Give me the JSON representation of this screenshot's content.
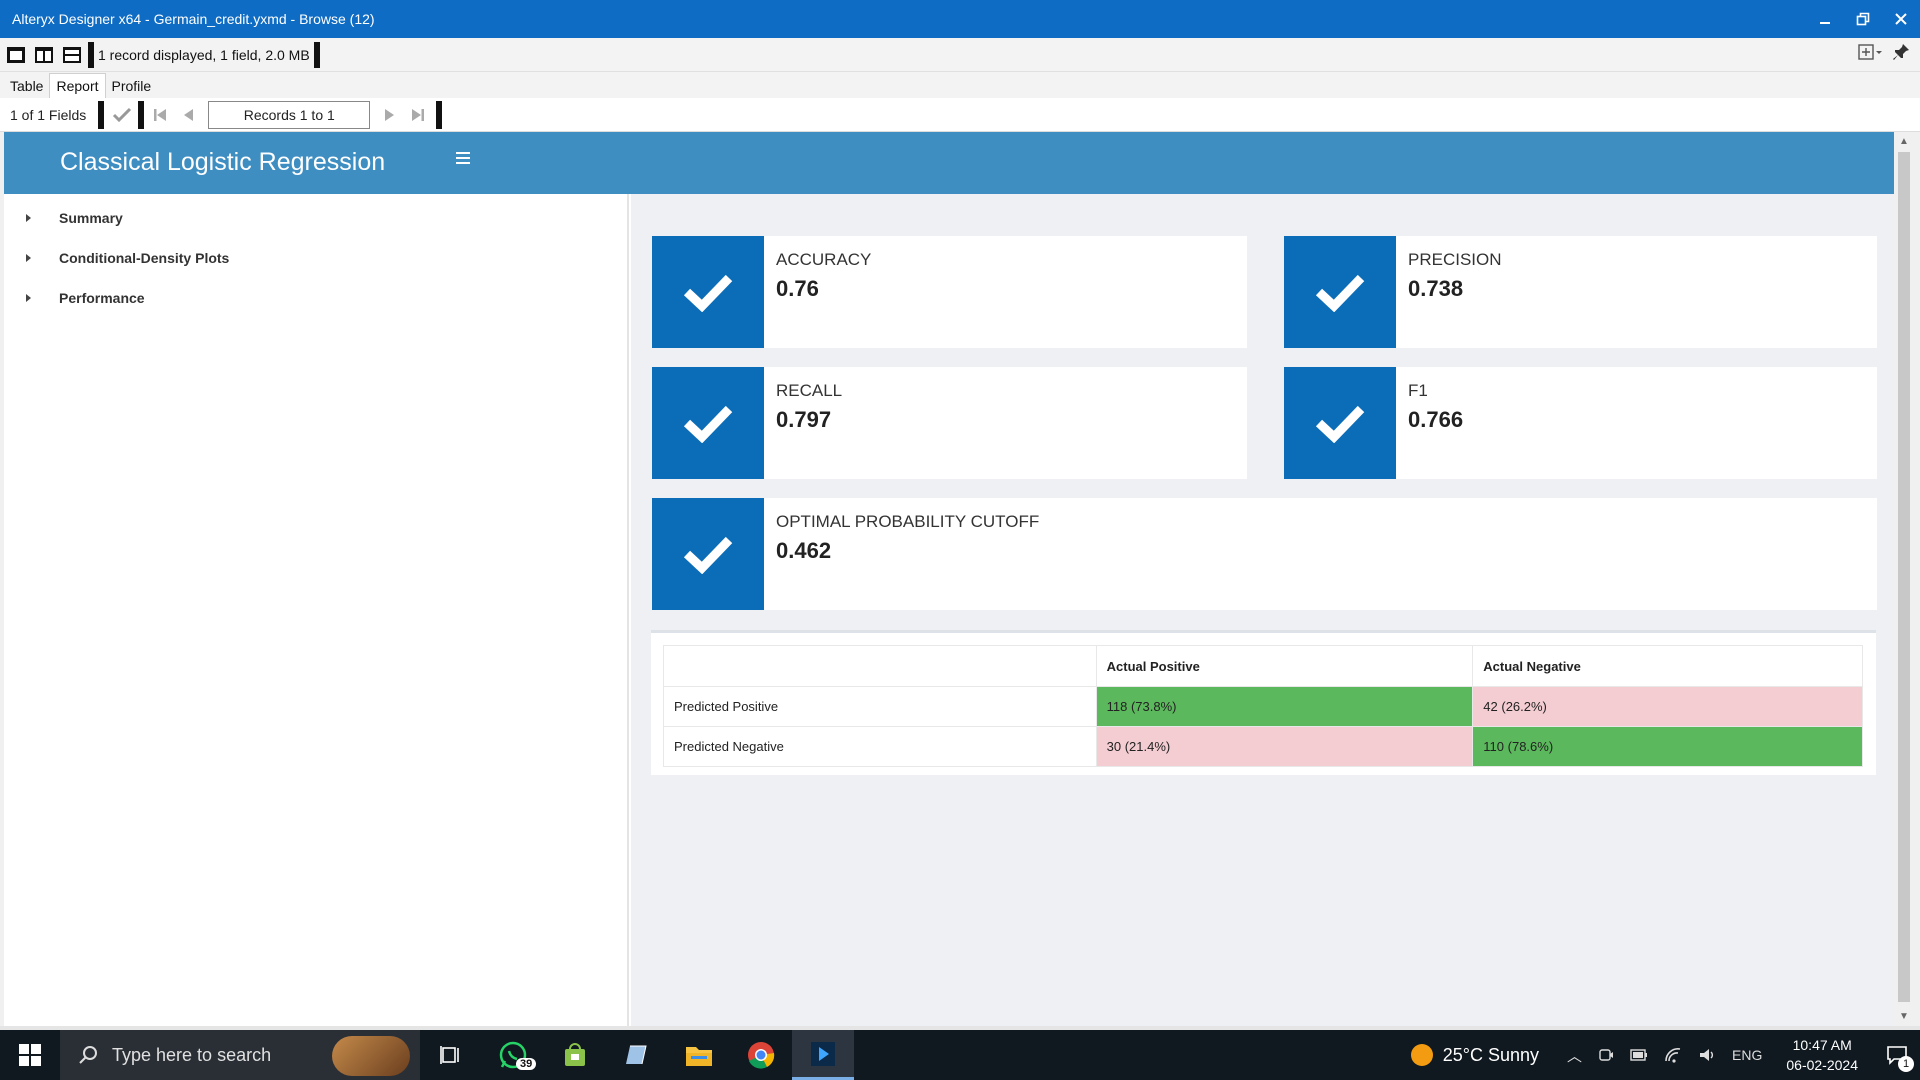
{
  "window": {
    "title": "Alteryx Designer x64 - Germain_credit.yxmd - Browse (12)"
  },
  "toolbar": {
    "info": "1 record displayed, 1 field, 2.0 MB"
  },
  "tabs": [
    {
      "label": "Table"
    },
    {
      "label": "Report"
    },
    {
      "label": "Profile"
    }
  ],
  "navigator": {
    "fields": "1 of 1 Fields",
    "records": "Records 1 to 1"
  },
  "report": {
    "title": "Classical Logistic Regression",
    "sidebar": [
      {
        "label": "Summary"
      },
      {
        "label": "Conditional-Density Plots"
      },
      {
        "label": "Performance"
      }
    ],
    "metrics": [
      {
        "label": "ACCURACY",
        "value": "0.76"
      },
      {
        "label": "PRECISION",
        "value": "0.738"
      },
      {
        "label": "RECALL",
        "value": "0.797"
      },
      {
        "label": "F1",
        "value": "0.766"
      },
      {
        "label": "OPTIMAL PROBABILITY CUTOFF",
        "value": "0.462"
      }
    ],
    "confusion_matrix": {
      "headers": [
        "",
        "Actual Positive",
        "Actual Negative"
      ],
      "rows": [
        {
          "label": "Predicted Positive",
          "cells": [
            "118 (73.8%)",
            "42 (26.2%)"
          ]
        },
        {
          "label": "Predicted Negative",
          "cells": [
            "30 (21.4%)",
            "110 (78.6%)"
          ]
        }
      ]
    }
  },
  "taskbar": {
    "search_placeholder": "Type here to search",
    "whatsapp_badge": "39",
    "weather": "25°C  Sunny",
    "language": "ENG",
    "time": "10:47 AM",
    "date": "06-02-2024",
    "notifications": "1"
  },
  "colors": {
    "titlebar": "#0e6cc4",
    "report_header": "#3e8ec2",
    "metric_icon": "#0b6db7",
    "cell_correct": "#5cb85c",
    "cell_error": "#f4cdd2"
  }
}
